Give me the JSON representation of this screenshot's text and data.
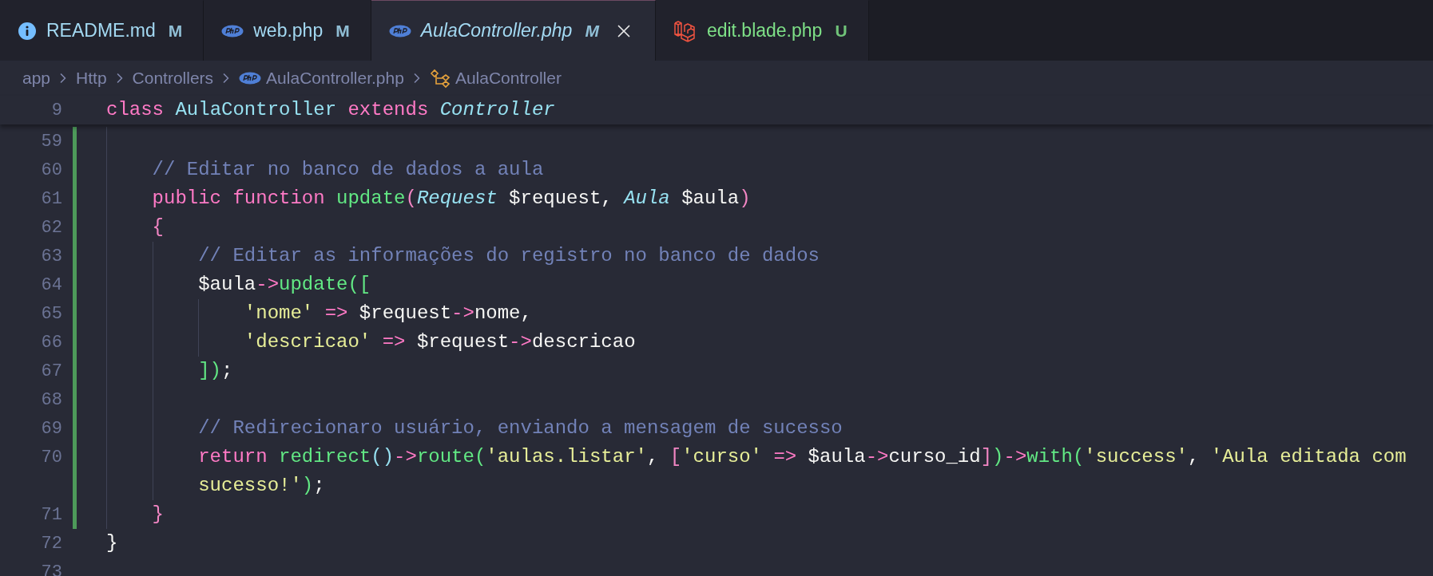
{
  "tabs": [
    {
      "kind": "info",
      "label": "README.md",
      "status": "M",
      "color": "#a3d9f2",
      "selected": false,
      "preview": false
    },
    {
      "kind": "php",
      "label": "web.php",
      "status": "M",
      "color": "#a3d9f2",
      "selected": false,
      "preview": false
    },
    {
      "kind": "php",
      "label": "AulaController.php",
      "status": "M",
      "color": "#a3d9f2",
      "selected": true,
      "preview": true
    },
    {
      "kind": "laravel",
      "label": "edit.blade.php",
      "status": "U",
      "color": "#7ee087",
      "selected": false,
      "preview": false
    }
  ],
  "breadcrumb": [
    {
      "label": "app"
    },
    {
      "label": "Http"
    },
    {
      "label": "Controllers"
    },
    {
      "kind": "php",
      "label": "AulaController.php"
    },
    {
      "kind": "class",
      "label": "AulaController"
    }
  ],
  "sticky_line": {
    "number": "9",
    "tokens": [
      {
        "kind": "keyword",
        "text": "class "
      },
      {
        "kind": "class",
        "text": "AulaController "
      },
      {
        "kind": "keyword",
        "text": "extends "
      },
      {
        "kind": "type",
        "text": "Controller"
      }
    ]
  },
  "lines": [
    {
      "number": "59",
      "modified": true
    },
    {
      "number": "60",
      "modified": true,
      "tokens": [
        {
          "kind": "comment",
          "text": "    // Editar no banco de dados a aula"
        }
      ]
    },
    {
      "number": "61",
      "modified": true,
      "tokens": [
        {
          "kind": "keyword",
          "text": "    public function "
        },
        {
          "kind": "function",
          "text": "update"
        },
        {
          "kind": "bracket-a",
          "text": "("
        },
        {
          "kind": "type",
          "text": "Request"
        },
        {
          "kind": "plain",
          "text": " $request, "
        },
        {
          "kind": "type",
          "text": "Aula"
        },
        {
          "kind": "plain",
          "text": " $aula"
        },
        {
          "kind": "bracket-a",
          "text": ")"
        }
      ]
    },
    {
      "number": "62",
      "modified": true,
      "tokens": [
        {
          "kind": "bracket-a",
          "text": "    {"
        }
      ]
    },
    {
      "number": "63",
      "modified": true,
      "tokens": [
        {
          "kind": "comment",
          "text": "        // Editar as informações do registro no banco de dados"
        }
      ]
    },
    {
      "number": "64",
      "modified": true,
      "tokens": [
        {
          "kind": "plain",
          "text": "        $aula"
        },
        {
          "kind": "operator",
          "text": "->"
        },
        {
          "kind": "function",
          "text": "update"
        },
        {
          "kind": "bracket-b",
          "text": "(["
        }
      ]
    },
    {
      "number": "65",
      "modified": true,
      "tokens": [
        {
          "kind": "string",
          "text": "            'nome'"
        },
        {
          "kind": "operator",
          "text": " =>"
        },
        {
          "kind": "plain",
          "text": " $request"
        },
        {
          "kind": "operator",
          "text": "->"
        },
        {
          "kind": "plain",
          "text": "nome,"
        }
      ]
    },
    {
      "number": "66",
      "modified": true,
      "tokens": [
        {
          "kind": "string",
          "text": "            'descricao'"
        },
        {
          "kind": "operator",
          "text": " =>"
        },
        {
          "kind": "plain",
          "text": " $request"
        },
        {
          "kind": "operator",
          "text": "->"
        },
        {
          "kind": "plain",
          "text": "descricao"
        }
      ]
    },
    {
      "number": "67",
      "modified": true,
      "tokens": [
        {
          "kind": "bracket-b",
          "text": "        ])"
        },
        {
          "kind": "plain",
          "text": ";"
        }
      ]
    },
    {
      "number": "68",
      "modified": true
    },
    {
      "number": "69",
      "modified": true,
      "tokens": [
        {
          "kind": "comment",
          "text": "        // Redirecionaro usuário, enviando a mensagem de sucesso"
        }
      ]
    },
    {
      "number": "70",
      "modified": true,
      "tokens": [
        {
          "kind": "keyword",
          "text": "        return "
        },
        {
          "kind": "function",
          "text": "redirect"
        },
        {
          "kind": "bracket-c",
          "text": "()"
        },
        {
          "kind": "operator",
          "text": "->"
        },
        {
          "kind": "function",
          "text": "route"
        },
        {
          "kind": "bracket-b",
          "text": "("
        },
        {
          "kind": "string",
          "text": "'aulas.listar'"
        },
        {
          "kind": "plain",
          "text": ", "
        },
        {
          "kind": "bracket-a",
          "text": "["
        },
        {
          "kind": "string",
          "text": "'curso'"
        },
        {
          "kind": "operator",
          "text": " =>"
        },
        {
          "kind": "plain",
          "text": " $aula"
        },
        {
          "kind": "operator",
          "text": "->"
        },
        {
          "kind": "plain",
          "text": "curso_id"
        },
        {
          "kind": "bracket-a",
          "text": "]"
        },
        {
          "kind": "bracket-b",
          "text": ")"
        },
        {
          "kind": "operator",
          "text": "->"
        },
        {
          "kind": "function",
          "text": "with"
        },
        {
          "kind": "bracket-b",
          "text": "("
        },
        {
          "kind": "string",
          "text": "'success'"
        },
        {
          "kind": "plain",
          "text": ", "
        },
        {
          "kind": "string",
          "text": "'Aula editada com"
        }
      ],
      "wrap": [
        {
          "kind": "string",
          "text": "        sucesso!'"
        },
        {
          "kind": "bracket-b",
          "text": ")"
        },
        {
          "kind": "plain",
          "text": ";"
        }
      ]
    },
    {
      "number": "71",
      "modified": true,
      "tokens": [
        {
          "kind": "bracket-a",
          "text": "    }"
        }
      ]
    },
    {
      "number": "72",
      "modified": false,
      "tokens": [
        {
          "kind": "plain",
          "text": "}"
        }
      ]
    },
    {
      "number": "73",
      "modified": false
    }
  ]
}
